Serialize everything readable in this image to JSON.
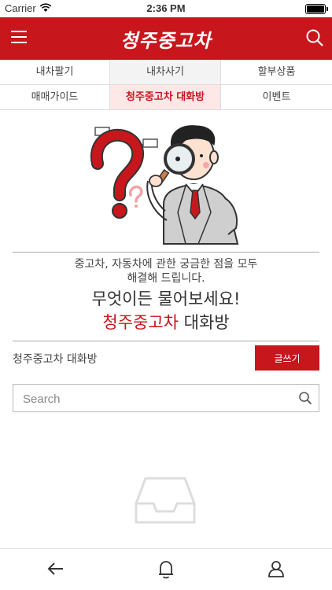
{
  "status_bar": {
    "carrier": "Carrier",
    "time": "2:36 PM"
  },
  "header": {
    "title": "청주중고차"
  },
  "tabs": [
    {
      "label": "내차팔기"
    },
    {
      "label": "내차사기"
    },
    {
      "label": "할부상품"
    },
    {
      "label": "매매가이드"
    },
    {
      "label": "청주중고차 대화방"
    },
    {
      "label": "이벤트"
    }
  ],
  "intro": {
    "line1": "중고차, 자동차에 관한 궁금한 점을 모두",
    "line2": "해결해 드립니다.",
    "headline1": "무엇이든 물어보세요!",
    "headline2_red": "청주중고차",
    "headline2_rest": " 대화방"
  },
  "board": {
    "label": "청주중고차 대화방",
    "write_button": "글쓰기"
  },
  "search": {
    "placeholder": "Search"
  },
  "colors": {
    "brand": "#c8161d"
  }
}
